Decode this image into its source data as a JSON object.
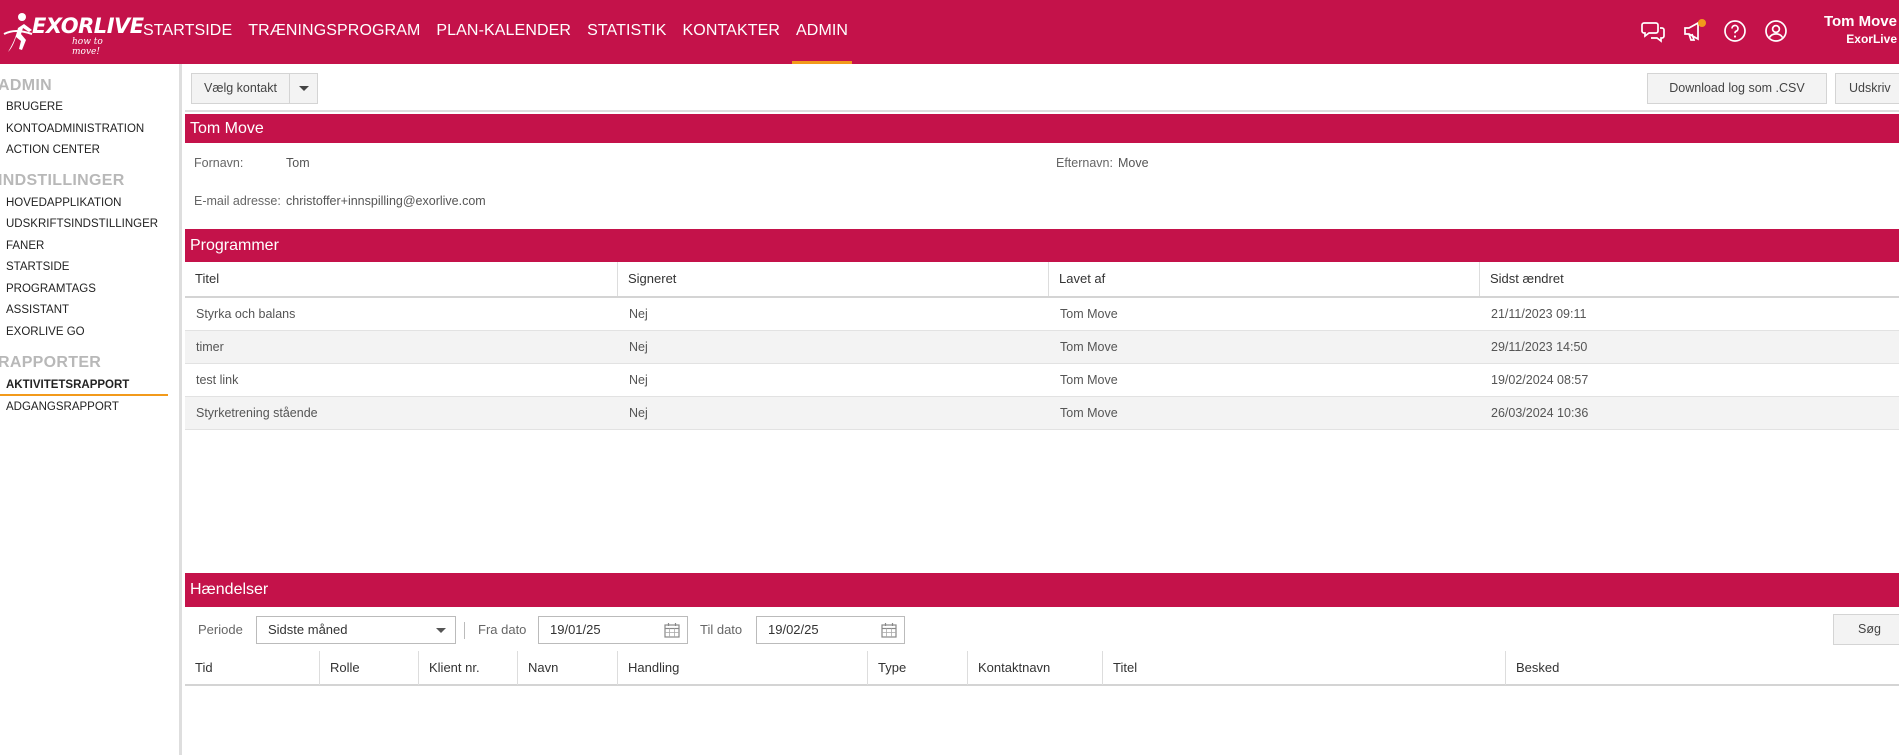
{
  "brand": {
    "name": "EXORLIVE",
    "tagline": "how to move!"
  },
  "nav": [
    {
      "label": "STARTSIDE"
    },
    {
      "label": "TRÆNINGSPROGRAM"
    },
    {
      "label": "PLAN-KALENDER"
    },
    {
      "label": "STATISTIK"
    },
    {
      "label": "KONTAKTER"
    },
    {
      "label": "ADMIN",
      "active": true
    }
  ],
  "user": {
    "name": "Tom Move",
    "org": "ExorLive"
  },
  "top_icons": [
    "chat-icon",
    "megaphone-icon",
    "help-icon",
    "account-icon"
  ],
  "sidebar": {
    "admin_head": "ADMIN",
    "admin_items": [
      "BRUGERE",
      "KONTOADMINISTRATION",
      "ACTION CENTER"
    ],
    "settings_head": "INDSTILLINGER",
    "settings_items": [
      "HOVEDAPPLIKATION",
      "UDSKRIFTSINDSTILLINGER",
      "FANER",
      "STARTSIDE",
      "PROGRAMTAGS",
      "ASSISTANT",
      "EXORLIVE GO"
    ],
    "reports_head": "RAPPORTER",
    "reports_items": [
      "AKTIVITETSRAPPORT",
      "ADGANGSRAPPORT"
    ]
  },
  "toolbar": {
    "choose_contact": "Vælg kontakt",
    "download_csv": "Download log som .CSV",
    "print": "Udskriv"
  },
  "contact": {
    "title": "Tom Move",
    "first_name_label": "Fornavn:",
    "first_name": "Tom",
    "last_name_label": "Efternavn:",
    "last_name": "Move",
    "email_label": "E-mail adresse:",
    "email": "christoffer+innspilling@exorlive.com"
  },
  "programs": {
    "title": "Programmer",
    "columns": [
      "Titel",
      "Signeret",
      "Lavet af",
      "Sidst ændret"
    ],
    "rows": [
      [
        "Styrka och balans",
        "Nej",
        "Tom Move",
        "21/11/2023 09:11"
      ],
      [
        "timer",
        "Nej",
        "Tom Move",
        "29/11/2023 14:50"
      ],
      [
        "test link",
        "Nej",
        "Tom Move",
        "19/02/2024 08:57"
      ],
      [
        "Styrketrening stående",
        "Nej",
        "Tom Move",
        "26/03/2024 10:36"
      ]
    ]
  },
  "events": {
    "title": "Hændelser",
    "period_label": "Periode",
    "period_value": "Sidste måned",
    "from_label": "Fra dato",
    "from_value": "19/01/25",
    "to_label": "Til dato",
    "to_value": "19/02/25",
    "search_label": "Søg",
    "columns": [
      "Tid",
      "Rolle",
      "Klient nr.",
      "Navn",
      "Handling",
      "Type",
      "Kontaktnavn",
      "Titel",
      "Besked"
    ]
  },
  "colors": {
    "primary": "#c4124a",
    "accent": "#f29a1b"
  }
}
